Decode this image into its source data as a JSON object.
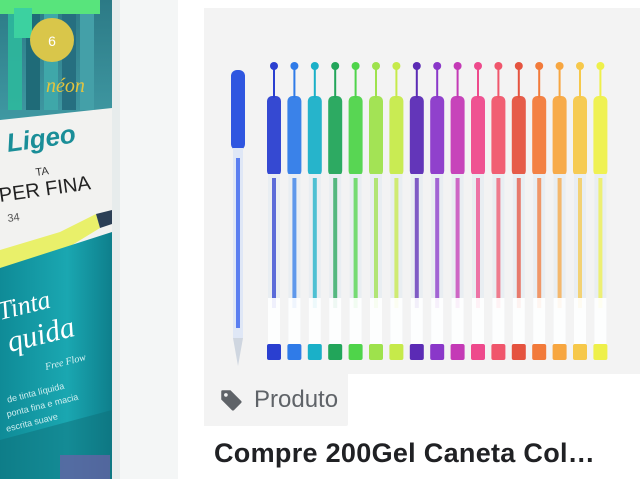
{
  "left_product": {
    "badge_word": "néon",
    "brand": "Ligeo",
    "line1": "TA",
    "line2": "PER FINA",
    "code": "34",
    "script1": "Tinta",
    "script2": "quida"
  },
  "right_product": {
    "badge_label": "Produto",
    "badge_icon": "tag-icon",
    "title": "Compre 200Gel Caneta Col…",
    "pen_colors": [
      "#2a3fd0",
      "#2f7be8",
      "#1ab0c8",
      "#22a55a",
      "#4fd44a",
      "#9ee24c",
      "#c6ea4a",
      "#5b2bb5",
      "#8a37c9",
      "#c43ab6",
      "#ee4a8c",
      "#f0566c",
      "#e5533f",
      "#f27a3a",
      "#f7a640",
      "#f6c84a",
      "#eef04a"
    ]
  }
}
